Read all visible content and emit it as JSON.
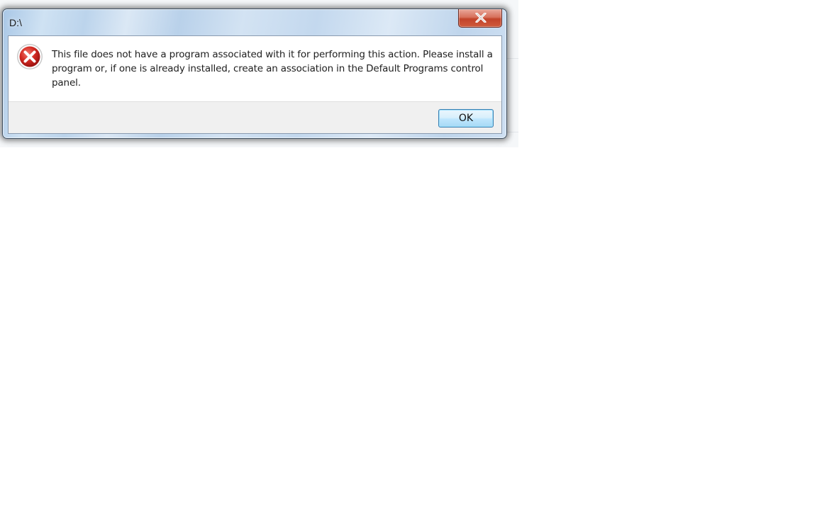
{
  "dialog": {
    "title": "D:\\",
    "message": "This file does not have a program associated with it for performing this action. Please install a program or, if one is already installed, create an association in the Default Programs control panel.",
    "ok_label": "OK",
    "close_icon": "close-icon",
    "status_icon": "error-icon"
  },
  "colors": {
    "error_red": "#c8211e",
    "close_button_red": "#c2432a",
    "ok_border": "#3c7fb1",
    "frame_blue": "#bcd4ec"
  }
}
